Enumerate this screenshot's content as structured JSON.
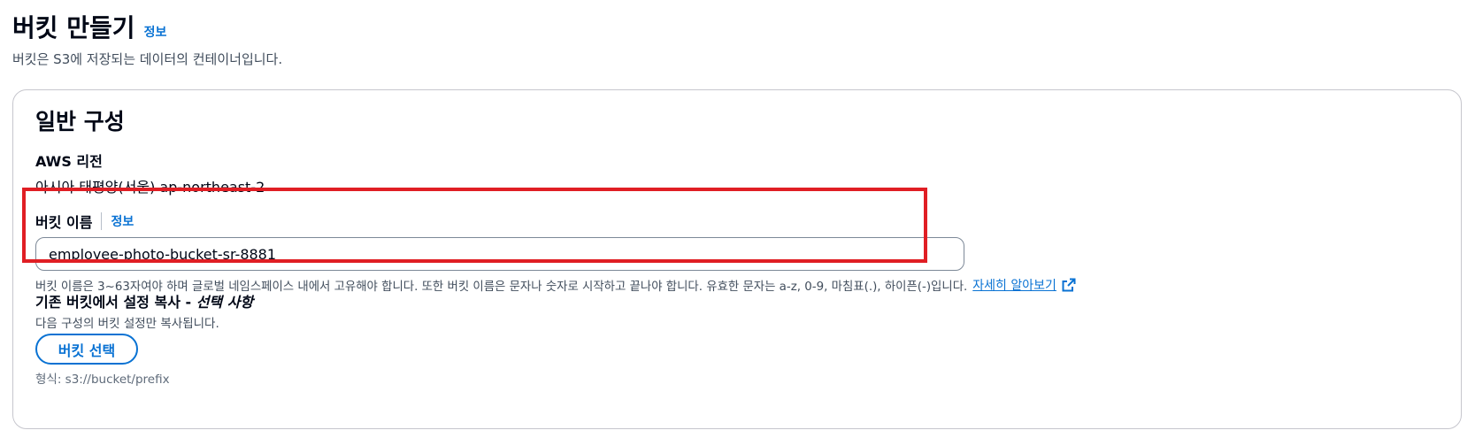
{
  "header": {
    "title": "버킷 만들기",
    "info_label": "정보",
    "description": "버킷은 S3에 저장되는 데이터의 컨테이너입니다."
  },
  "general_config": {
    "section_title": "일반 구성",
    "region": {
      "label": "AWS 리전",
      "value": "아시아 태평양(서울) ap-northeast-2"
    },
    "bucket_name": {
      "label": "버킷 이름",
      "info_label": "정보",
      "value": "employee-photo-bucket-sr-8881",
      "constraint_text": "버킷 이름은 3~63자여야 하며 글로벌 네임스페이스 내에서 고유해야 합니다. 또한 버킷 이름은 문자나 숫자로 시작하고 끝나야 합니다. 유효한 문자는 a-z, 0-9, 마침표(.), 하이픈(-)입니다.",
      "learn_more_label": "자세히 알아보기"
    },
    "copy_settings": {
      "label": "기존 버킷에서 설정 복사 - ",
      "optional_label": "선택 사항",
      "description": "다음 구성의 버킷 설정만 복사됩니다.",
      "choose_button_label": "버킷 선택",
      "format_hint": "형식: s3://bucket/prefix"
    }
  },
  "colors": {
    "link": "#0972d3",
    "highlight": "#e01e24",
    "text": "#000716",
    "secondary_text": "#414d5c"
  },
  "icons": {
    "learn_more": "external-link-icon"
  }
}
